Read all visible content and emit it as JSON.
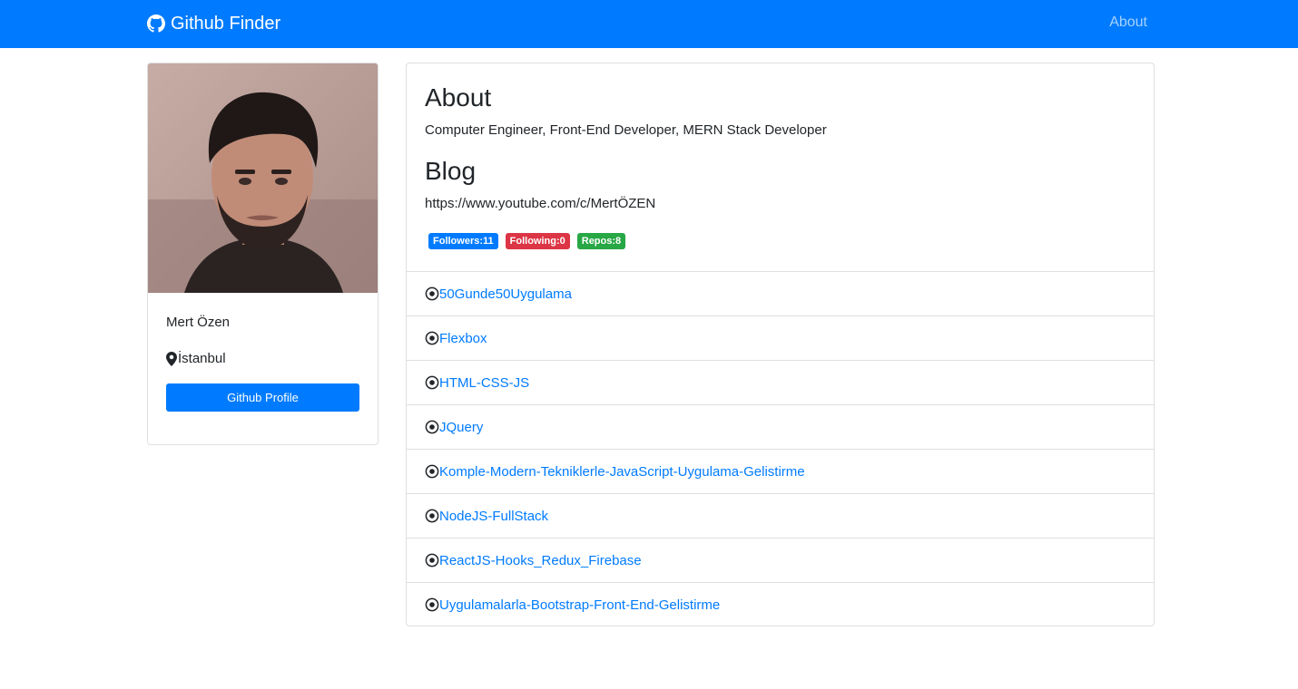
{
  "navbar": {
    "brand": "Github Finder",
    "about_link": "About",
    "bg_color": "#007bff"
  },
  "profile": {
    "name": "Mert Özen",
    "location": "İstanbul",
    "button_label": "Github Profile",
    "location_icon": "map-marker-icon"
  },
  "about": {
    "heading": "About",
    "bio": "Computer Engineer, Front-End Developer, MERN Stack Developer"
  },
  "blog": {
    "heading": "Blog",
    "url": "https://www.youtube.com/c/MertÖZEN"
  },
  "badges": [
    {
      "label": "Followers:11",
      "color": "#007bff"
    },
    {
      "label": "Following:0",
      "color": "#dc3545"
    },
    {
      "label": "Repos:8",
      "color": "#28a745"
    }
  ],
  "repos": [
    "50Gunde50Uygulama",
    "Flexbox",
    "HTML-CSS-JS",
    "JQuery",
    "Komple-Modern-Tekniklerle-JavaScript-Uygulama-Gelistirme",
    "NodeJS-FullStack",
    "ReactJS-Hooks_Redux_Firebase",
    "Uygulamalarla-Bootstrap-Front-End-Gelistirme"
  ],
  "colors": {
    "accent": "#007bff",
    "link": "#007bff",
    "text": "#212529"
  }
}
